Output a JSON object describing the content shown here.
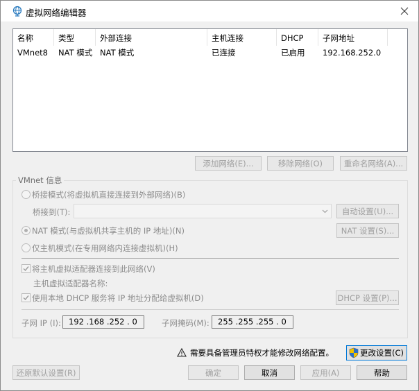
{
  "window": {
    "title": "虚拟网络编辑器"
  },
  "list": {
    "columns": [
      "名称",
      "类型",
      "外部连接",
      "主机连接",
      "DHCP",
      "子网地址"
    ],
    "rows": [
      [
        "VMnet8",
        "NAT 模式",
        "NAT 模式",
        "已连接",
        "已启用",
        "192.168.252.0"
      ]
    ]
  },
  "list_buttons": {
    "add": "添加网络(E)...",
    "remove": "移除网络(O)",
    "rename": "重命名网络(A)..."
  },
  "vmnet_info": {
    "legend": "VMnet 信息",
    "bridge_mode": "桥接模式(将虚拟机直接连接到外部网络)(B)",
    "bridge_to_label": "桥接到(T):",
    "auto_settings": "自动设置(U)...",
    "nat_mode": "NAT 模式(与虚拟机共享主机的 IP 地址)(N)",
    "nat_settings": "NAT 设置(S)...",
    "host_only": "仅主机模式(在专用网络内连接虚拟机)(H)",
    "connect_adapter": "将主机虚拟适配器连接到此网络(V)",
    "adapter_name_label": "主机虚拟适配器名称:",
    "use_dhcp": "使用本地 DHCP 服务将 IP 地址分配给虚拟机(D)",
    "dhcp_settings": "DHCP 设置(P)...",
    "subnet_ip_label": "子网 IP (I):",
    "subnet_ip": "192 .168 .252 . 0",
    "subnet_mask_label": "子网掩码(M):",
    "subnet_mask": "255 .255 .255 . 0"
  },
  "notice": {
    "text": "需要具备管理员特权才能修改网络配置。",
    "change_settings": "更改设置(C)"
  },
  "footer": {
    "restore_defaults": "还原默认设置(R)",
    "ok": "确定",
    "cancel": "取消",
    "apply": "应用(A)",
    "help": "帮助"
  },
  "state": {
    "selected_mode": "nat",
    "connect_adapter_checked": true,
    "use_dhcp_checked": true
  },
  "colors": {
    "accent": "#0078d7",
    "disabled_text": "#a0a0a0"
  }
}
